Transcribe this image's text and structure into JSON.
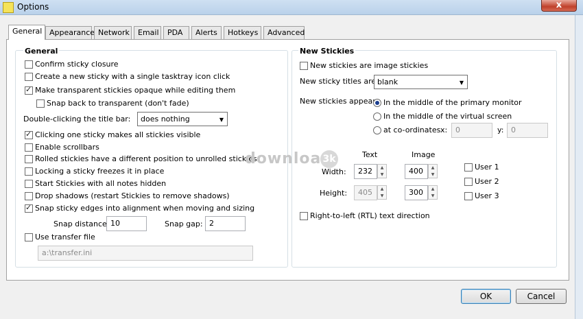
{
  "window": {
    "title": "Options",
    "close_label": "x"
  },
  "tabs": [
    "General",
    "Appearance",
    "Network",
    "Email",
    "PDA",
    "Alerts",
    "Hotkeys",
    "Advanced"
  ],
  "general": {
    "title": "General",
    "confirm_closure": "Confirm sticky closure",
    "single_click": "Create a new sticky with a single tasktray icon click",
    "transparent_opaque": "Make transparent stickies opaque while editing them",
    "snap_back": "Snap back to transparent (don't fade)",
    "double_click_label": "Double-clicking the title bar:",
    "double_click_value": "does nothing",
    "click_one": "Clicking one sticky makes all stickies visible",
    "scrollbars": "Enable scrollbars",
    "rolled": "Rolled stickies have a different position to unrolled stickies",
    "locking": "Locking a sticky freezes it in place",
    "start_hidden": "Start Stickies with all notes hidden",
    "drop_shadows": "Drop shadows (restart Stickies to remove shadows)",
    "snap_edges": "Snap sticky edges into alignment when moving and sizing",
    "snap_distance_label": "Snap distance:",
    "snap_distance_value": "10",
    "snap_gap_label": "Snap gap:",
    "snap_gap_value": "2",
    "transfer_label": "Use transfer file",
    "transfer_value": "a:\\transfer.ini"
  },
  "new_stickies": {
    "title": "New Stickies",
    "image_stickies": "New stickies are image stickies",
    "titles_label": "New sticky titles are:",
    "titles_value": "blank",
    "appear_label": "New stickies appear:",
    "primary": "In the middle of the primary monitor",
    "virtual": "In the middle of the virtual screen",
    "coords": "at co-ordinates",
    "x_label": "x:",
    "x_value": "0",
    "y_label": "y:",
    "y_value": "0",
    "text_header": "Text",
    "image_header": "Image",
    "width_label": "Width:",
    "height_label": "Height:",
    "text_width": "232",
    "text_height": "405",
    "image_width": "400",
    "image_height": "300",
    "user1": "User 1",
    "user2": "User 2",
    "user3": "User 3",
    "rtl": "Right-to-left (RTL) text direction"
  },
  "buttons": {
    "ok": "OK",
    "cancel": "Cancel"
  },
  "watermark": {
    "text": "download",
    "badge": "3k"
  }
}
